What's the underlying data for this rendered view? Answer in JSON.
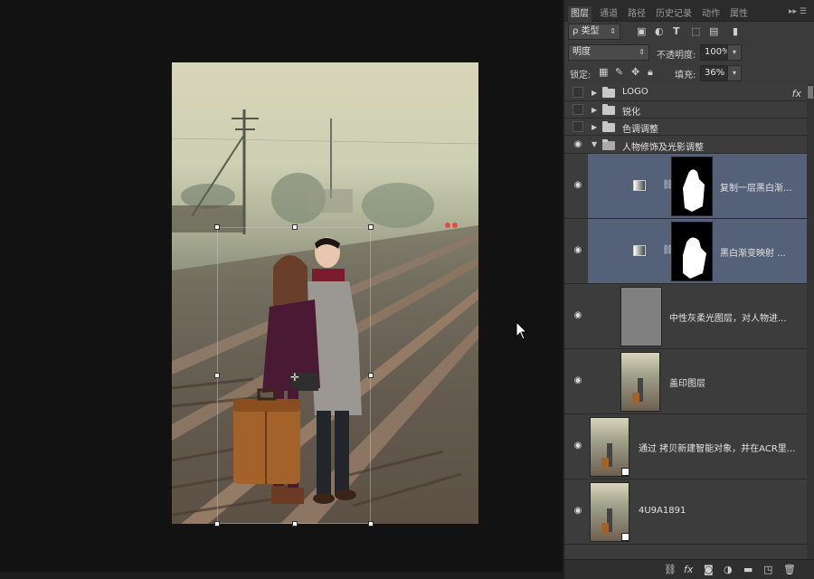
{
  "panel": {
    "tabs": [
      "图层",
      "通道",
      "路径",
      "历史记录",
      "动作",
      "属性"
    ],
    "menu_icon": "double-chevron-menu-icon",
    "filter": {
      "label": "ρ 类型"
    },
    "blend_mode": "明度",
    "opacity_label": "不透明度:",
    "opacity_value": "100%",
    "lock_label": "锁定:",
    "fill_label": "填充:",
    "fill_value": "36%"
  },
  "layers": [
    {
      "name": "LOGO",
      "type": "group",
      "visible": false,
      "fx": "fx"
    },
    {
      "name": "锐化",
      "type": "group",
      "visible": false
    },
    {
      "name": "色调调整",
      "type": "group",
      "visible": false
    },
    {
      "name": "人物修饰及光影调整",
      "type": "group-open",
      "visible": true
    },
    {
      "name": "复制一层黑白渐...",
      "type": "adjustment",
      "selected": true
    },
    {
      "name": "黑白渐变映射 ...",
      "type": "adjustment",
      "selected": true
    },
    {
      "name": "中性灰柔光图层，对人物进...",
      "type": "gray"
    },
    {
      "name": "盖印图层",
      "type": "photo"
    },
    {
      "name": "通过 拷贝新建智能对象，并在ACR里...",
      "type": "smart"
    },
    {
      "name": "4U9A1891",
      "type": "smart"
    }
  ],
  "footer_icons": [
    "link-icon",
    "fx-icon",
    "mask-icon",
    "adjustment-icon",
    "folder-icon",
    "new-layer-icon",
    "trash-icon"
  ],
  "footer_fx": "fx",
  "colors": {
    "panel_bg": "#3b3b3b",
    "selected_row": "#556179",
    "canvas_bg": "#121212"
  }
}
